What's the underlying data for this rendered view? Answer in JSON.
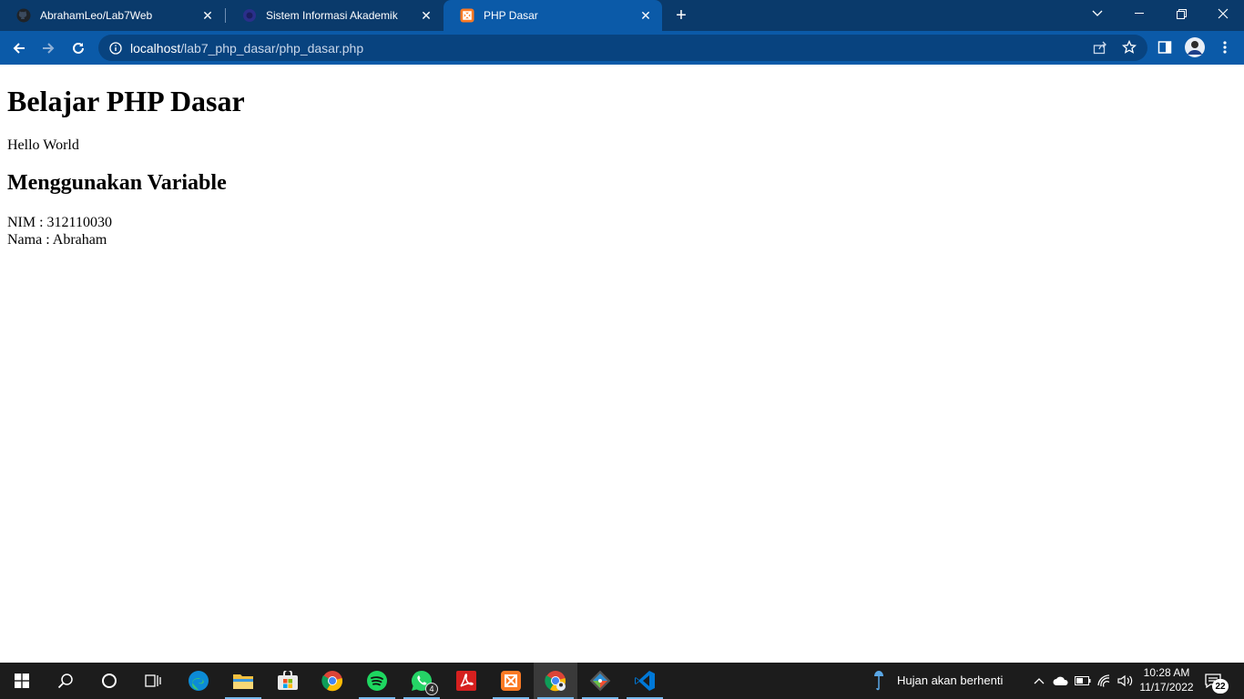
{
  "browser": {
    "tabs": [
      {
        "title": "AbrahamLeo/Lab7Web",
        "favicon": "github-icon",
        "active": false
      },
      {
        "title": "Sistem Informasi Akademik",
        "favicon": "campus-logo-icon",
        "active": false
      },
      {
        "title": "PHP Dasar",
        "favicon": "xampp-icon",
        "active": true
      }
    ],
    "address": {
      "host": "localhost",
      "path": "/lab7_php_dasar/php_dasar.php"
    },
    "colors": {
      "tabstrip": "#0a3a6b",
      "toolbar": "#0b5aa8",
      "omnibox": "#08437f"
    }
  },
  "page": {
    "heading": "Belajar PHP Dasar",
    "hello": "Hello World",
    "subheading": "Menggunakan Variable",
    "nim": "NIM : 312110030",
    "nama": "Nama : Abraham"
  },
  "taskbar": {
    "apps": [
      "windows-start-icon",
      "search-icon",
      "cortana-icon",
      "task-view-icon",
      "edge-icon",
      "file-explorer-icon",
      "microsoft-store-icon",
      "chrome-icon",
      "spotify-icon",
      "whatsapp-icon",
      "acrobat-icon",
      "xampp-icon",
      "chrome-profile-icon",
      "git-icon",
      "vscode-icon"
    ],
    "whatsapp_badge": "4",
    "weather": "Hujan akan berhenti",
    "time": "10:28 AM",
    "date": "11/17/2022",
    "notifications": "22"
  }
}
